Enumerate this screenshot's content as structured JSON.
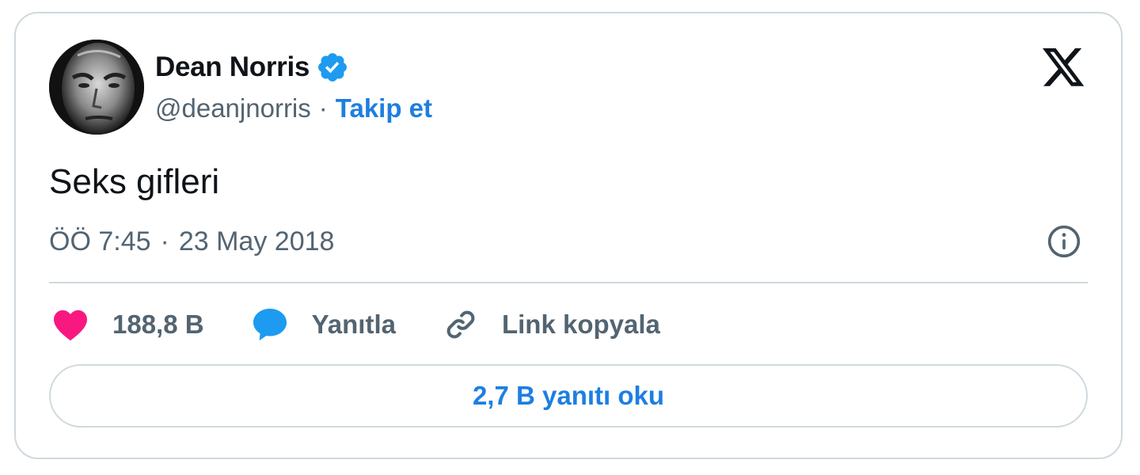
{
  "tweet": {
    "author": {
      "display_name": "Dean Norris",
      "handle": "@deanjnorris",
      "verified": true
    },
    "separator": "·",
    "follow_label": "Takip et",
    "text": "Seks gifleri",
    "time": "ÖÖ 7:45",
    "date": "23 May 2018",
    "likes_count": "188,8 B",
    "reply_label": "Yanıtla",
    "copy_link_label": "Link kopyala",
    "read_replies_label": "2,7 B yanıtı oku"
  },
  "icons": {
    "brand": "x-logo-icon",
    "verified": "verified-badge-icon",
    "info": "info-icon",
    "like": "heart-icon",
    "reply": "speech-bubble-icon",
    "link": "link-icon"
  },
  "colors": {
    "accent": "#1d7fe0",
    "heart": "#f91880",
    "muted_text": "#536471",
    "primary_text": "#0f1419",
    "border": "#cfd9de"
  }
}
